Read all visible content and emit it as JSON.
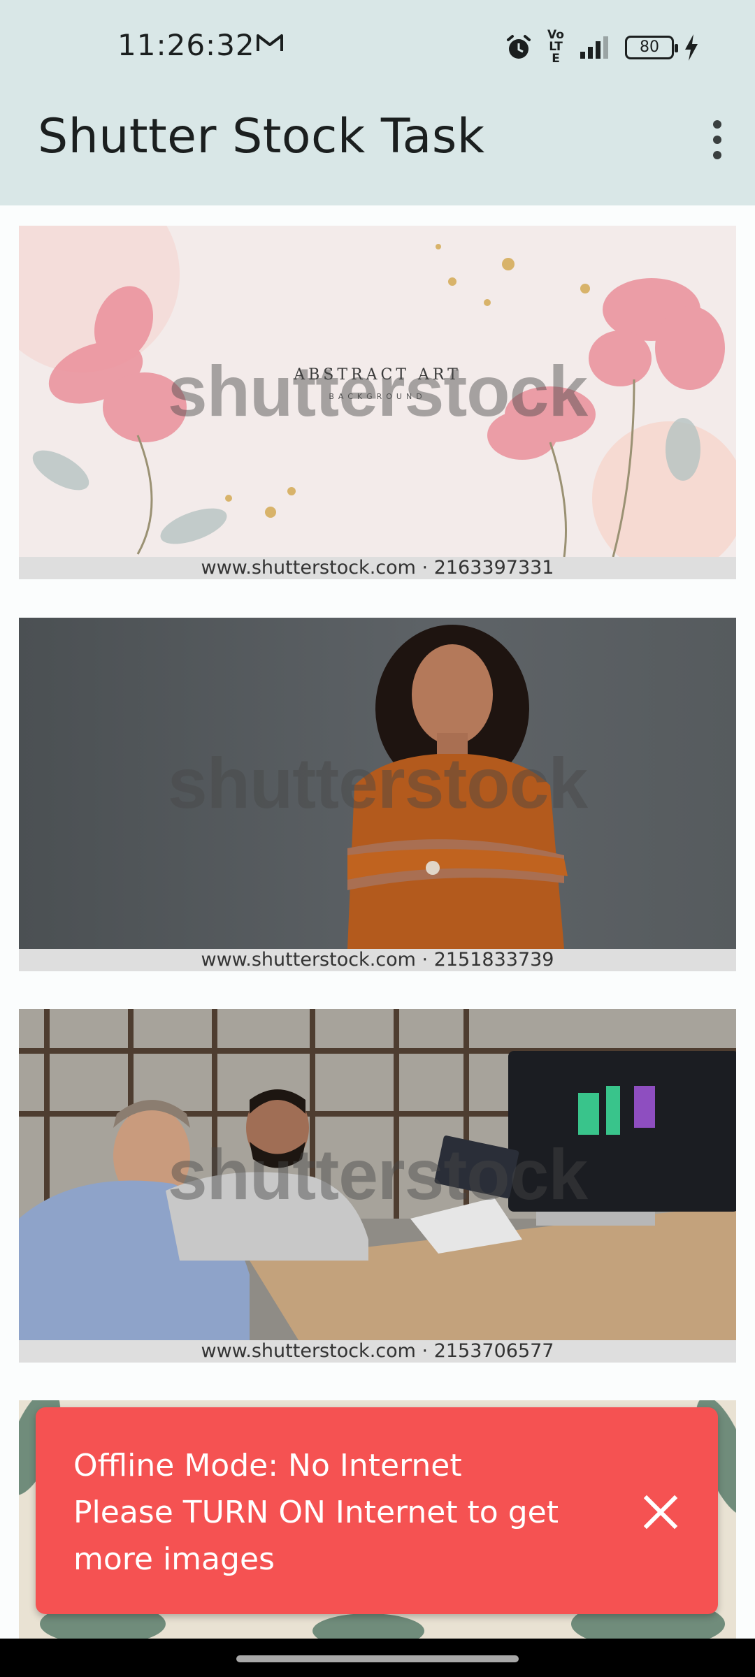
{
  "status_bar": {
    "time": "11:26:32",
    "notification_icon": "gmail-icon",
    "volte": "Vo LTE",
    "battery": "80"
  },
  "app_bar": {
    "title": "Shutter Stock Task",
    "menu_icon": "more-vert-icon"
  },
  "feed": {
    "watermark": "shutterstock",
    "items": [
      {
        "caption": "www.shutterstock.com · 2163397331",
        "overlay_title": "ABSTRACT ART",
        "overlay_sub": "BACKGROUND"
      },
      {
        "caption": "www.shutterstock.com · 2151833739"
      },
      {
        "caption": "www.shutterstock.com · 2153706577"
      },
      {
        "caption": ""
      }
    ]
  },
  "snackbar": {
    "line1": "Offline Mode: No Internet",
    "line2": "Please TURN ON Internet to get",
    "line3": "more images",
    "close_icon": "close-icon",
    "color": "#f55252"
  },
  "colors": {
    "app_bar_bg": "#d9e7e7",
    "background": "#fbfdfd"
  }
}
